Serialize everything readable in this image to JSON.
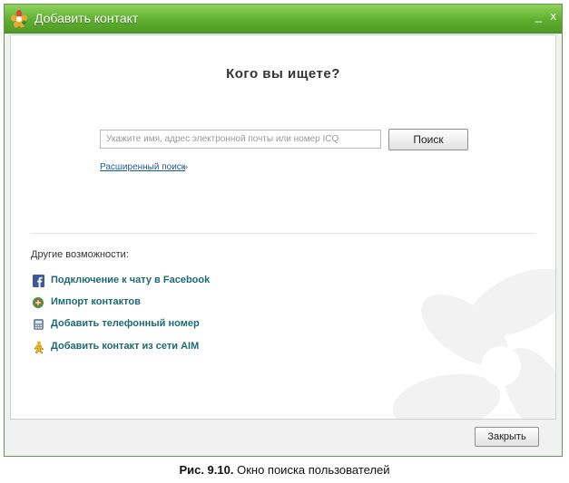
{
  "window": {
    "title": "Добавить контакт",
    "minimize_glyph": "_",
    "close_glyph": "x"
  },
  "main": {
    "heading": "Кого вы ищете?",
    "search": {
      "placeholder": "Укажите имя, адрес электронной почты или номер ICQ",
      "value": "",
      "button_label": "Поиск"
    },
    "advanced_search_label": "Расширенный поиск",
    "advanced_search_chevron": "»"
  },
  "other_options": {
    "label": "Другие возможности:",
    "items": [
      {
        "label": "Подключение к чату в Facebook",
        "icon": "facebook-icon"
      },
      {
        "label": "Импорт контактов",
        "icon": "import-contacts-icon"
      },
      {
        "label": "Добавить телефонный номер",
        "icon": "phone-icon"
      },
      {
        "label": "Добавить контакт из сети AIM",
        "icon": "aim-icon"
      }
    ]
  },
  "footer": {
    "close_label": "Закрыть"
  },
  "caption": {
    "figure_label": "Рис. 9.10.",
    "text": "Окно поиска пользователей"
  },
  "colors": {
    "titlebar": "#5fae2f",
    "link": "#1d5c9a",
    "option_text": "#1d6a73"
  }
}
